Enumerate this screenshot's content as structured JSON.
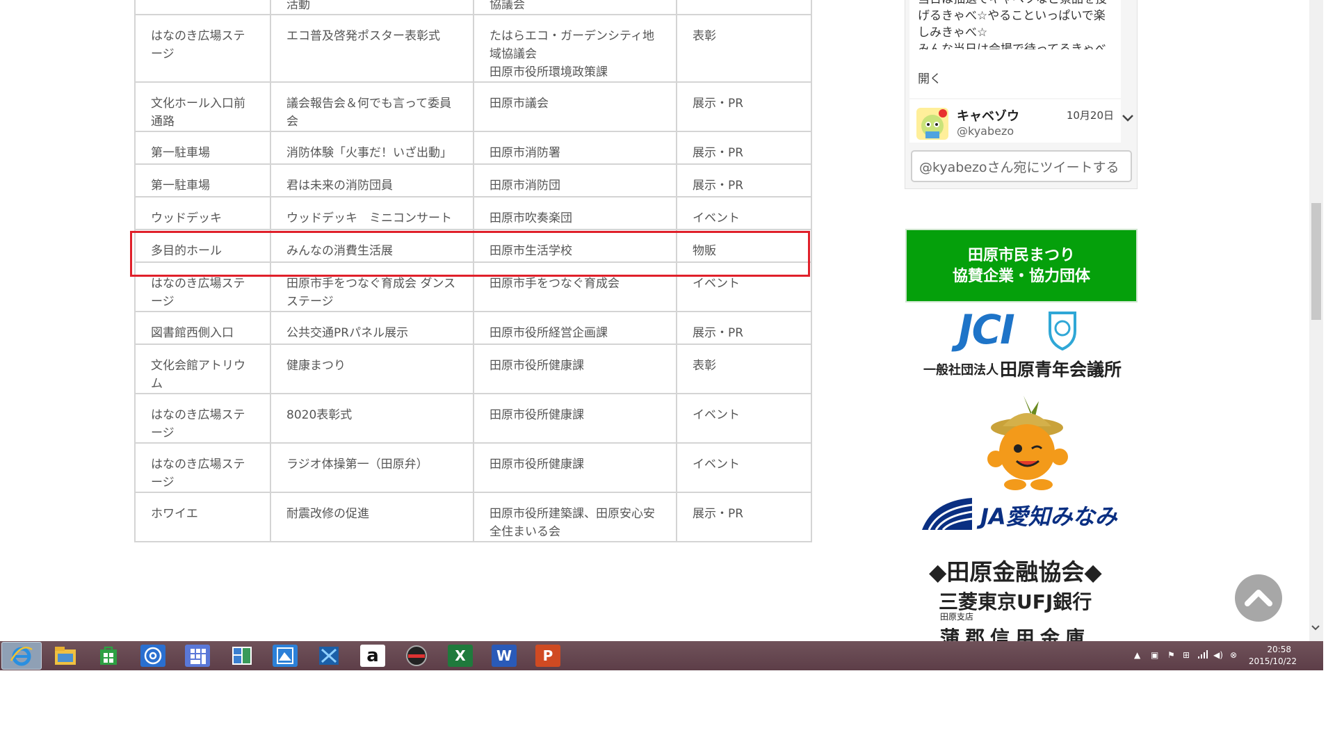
{
  "events": {
    "rows": [
      {
        "place": "",
        "name": "活動",
        "org": "協議会",
        "type": ""
      },
      {
        "place": "はなのき広場ステージ",
        "name": "エコ普及啓発ポスター表彰式",
        "org": "たはらエコ・ガーデンシティ地域協議会\n田原市役所環境政策課",
        "type": "表彰"
      },
      {
        "place": "文化ホール入口前通路",
        "name": "議会報告会＆何でも言って委員会",
        "org": "田原市議会",
        "type": "展示・PR"
      },
      {
        "place": "第一駐車場",
        "name": "消防体験「火事だ！いざ出動」",
        "org": "田原市消防署",
        "type": "展示・PR"
      },
      {
        "place": "第一駐車場",
        "name": "君は未来の消防団員",
        "org": "田原市消防団",
        "type": "展示・PR"
      },
      {
        "place": "ウッドデッキ",
        "name": "ウッドデッキ　ミニコンサート",
        "org": "田原市吹奏楽団",
        "type": "イベント"
      },
      {
        "place": "多目的ホール",
        "name": "みんなの消費生活展",
        "org": "田原市生活学校",
        "type": "物販"
      },
      {
        "place": "はなのき広場ステージ",
        "name": "田原市手をつなぐ育成会 ダンスステージ",
        "org": "田原市手をつなぐ育成会",
        "type": "イベント"
      },
      {
        "place": "図書館西側入口",
        "name": "公共交通PRパネル展示",
        "org": "田原市役所経営企画課",
        "type": "展示・PR"
      },
      {
        "place": "文化会館アトリウム",
        "name": "健康まつり",
        "org": "田原市役所健康課",
        "type": "表彰"
      },
      {
        "place": "はなのき広場ステージ",
        "name": "8020表彰式",
        "org": "田原市役所健康課",
        "type": "イベント"
      },
      {
        "place": "はなのき広場ステージ",
        "name": "ラジオ体操第一（田原弁）",
        "org": "田原市役所健康課",
        "type": "イベント"
      },
      {
        "place": "ホワイエ",
        "name": "耐震改修の促進",
        "org": "田原市役所建築課、田原安心安全住まいる会",
        "type": "展示・PR"
      }
    ]
  },
  "twitter": {
    "tweet_text": "当日は抽選でキャベツなど景品を投げるきゃべ☆やることいっぱいで楽しみきゃべ☆\nみんな当日は会場で待ってるきゃべ☆",
    "open_label": "開く",
    "user_name": "キャベゾウ",
    "user_handle": "@kyabezo",
    "tweet_date": "10月20日",
    "compose_placeholder": "@kyabezoさん宛にツイートする"
  },
  "sponsors": {
    "banner_line1": "田原市民まつり",
    "banner_line2": "協賛企業・協力団体",
    "jci_logo_text": "JCI",
    "jci_org_prefix": "一般社団法人",
    "jci_org_name": "田原青年会議所",
    "ja_name": "JA愛知みなみ",
    "kinyu_title": "◆田原金融協会◆",
    "bank_name": "三菱東京UFJ銀行",
    "bank_branch": "田原支店",
    "shinkin_name": "蒲郡信用金庫"
  },
  "taskbar": {
    "excel_letter": "X",
    "word_letter": "W",
    "ppt_letter": "P",
    "amazon_letter": "a",
    "clock_time": "20:58",
    "clock_date": "2015/10/22"
  },
  "colors": {
    "highlight": "#e0202a",
    "sponsor_banner": "#05a00b",
    "taskbar": "#5d3e48",
    "jci_blue": "#1e74c8"
  }
}
